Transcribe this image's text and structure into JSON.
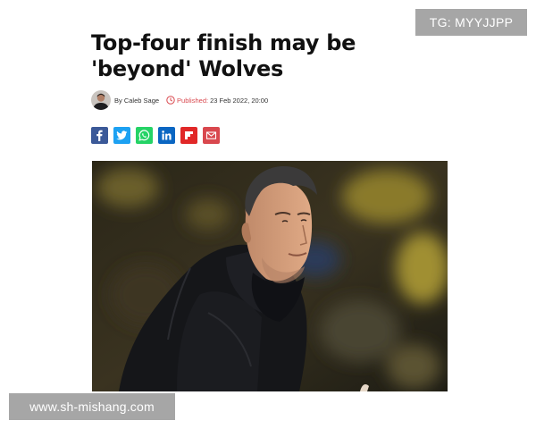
{
  "article": {
    "title": "Top-four finish may be 'beyond' Wolves",
    "author": "By Caleb Sage",
    "published_label": "Published:",
    "published_date": "23 Feb 2022, 20:00"
  },
  "share": [
    {
      "network": "facebook",
      "icon": "facebook-icon",
      "color": "#3b5998"
    },
    {
      "network": "twitter",
      "icon": "twitter-icon",
      "color": "#1da1f2"
    },
    {
      "network": "whatsapp",
      "icon": "whatsapp-icon",
      "color": "#25d366"
    },
    {
      "network": "linkedin",
      "icon": "linkedin-icon",
      "color": "#0a66c2"
    },
    {
      "network": "flipboard",
      "icon": "flipboard-icon",
      "color": "#e12828"
    },
    {
      "network": "email",
      "icon": "email-icon",
      "color": "#d9484e"
    }
  ],
  "watermarks": {
    "top_right": "TG: MYYJJPP",
    "bottom_left": "www.sh-mishang.com"
  },
  "colors": {
    "accent": "#d9484e",
    "headline": "#111111"
  }
}
